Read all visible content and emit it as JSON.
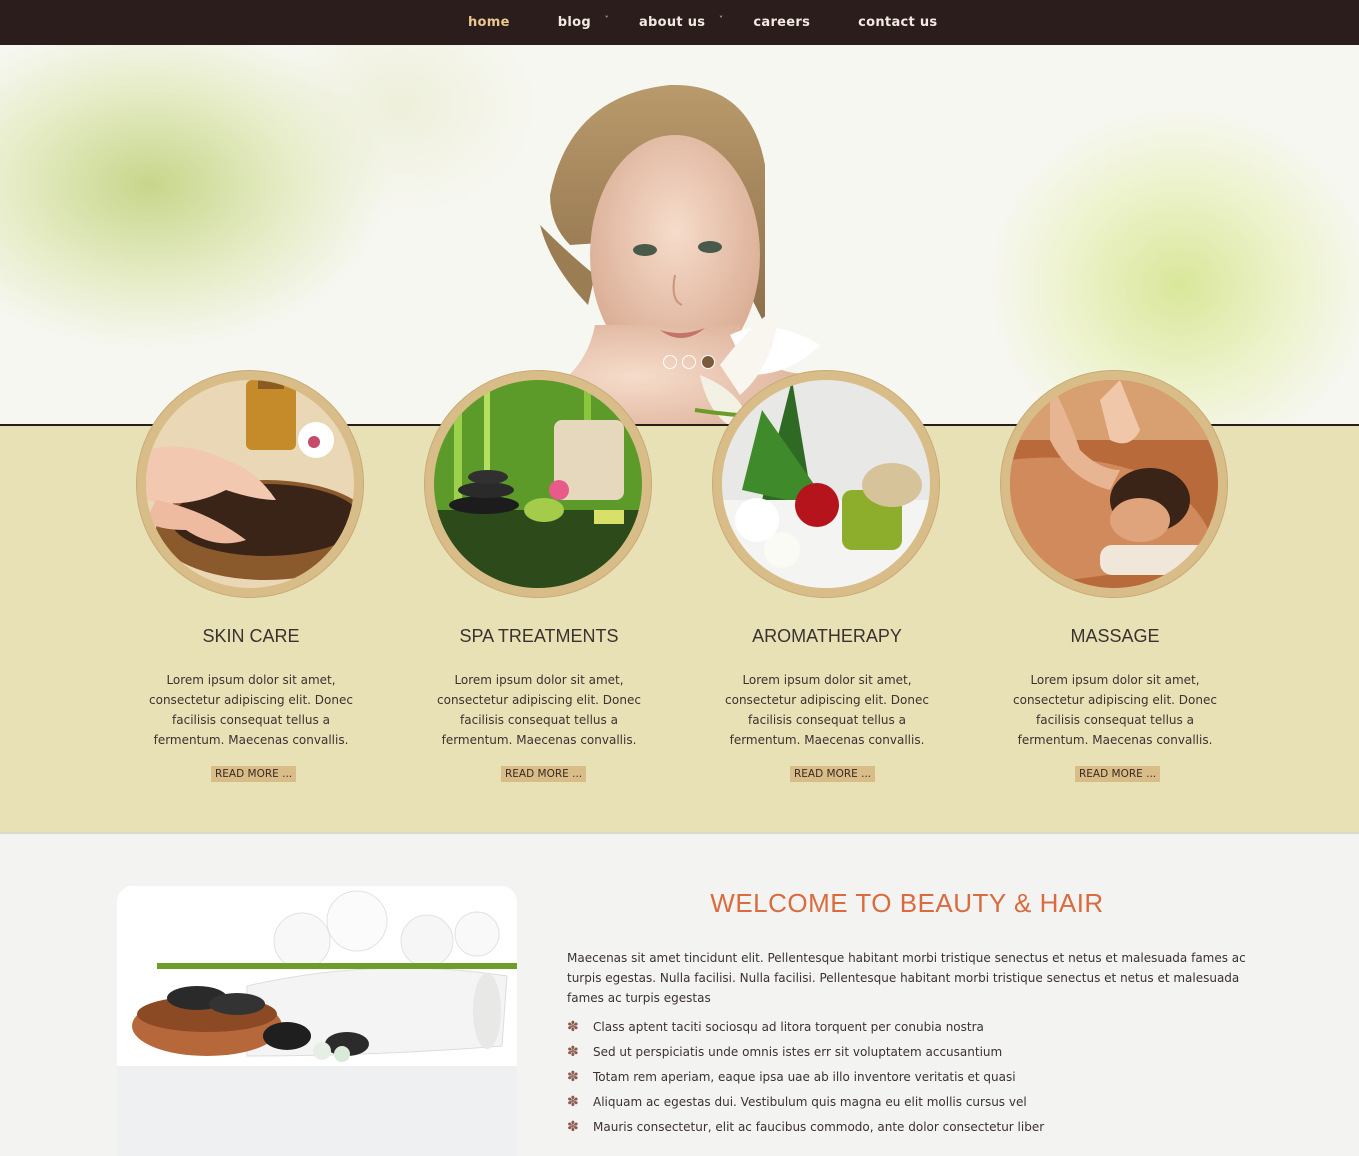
{
  "nav": {
    "items": [
      {
        "label": "home",
        "active": true,
        "caret": false
      },
      {
        "label": "blog",
        "active": false,
        "caret": true
      },
      {
        "label": "about us",
        "active": false,
        "caret": true
      },
      {
        "label": "careers",
        "active": false,
        "caret": false
      },
      {
        "label": "contact us",
        "active": false,
        "caret": false
      }
    ]
  },
  "slider": {
    "dot_count": 3,
    "active_index": 2
  },
  "features": [
    {
      "title": "SKIN CARE",
      "text": "Lorem ipsum dolor sit amet, consectetur adipiscing elit. Donec facilisis consequat tellus a fermentum. Maecenas convallis.",
      "button": "READ MORE ..."
    },
    {
      "title": "SPA TREATMENTS",
      "text": "Lorem ipsum dolor sit amet, consectetur adipiscing elit. Donec facilisis consequat tellus a fermentum. Maecenas convallis.",
      "button": "READ MORE ..."
    },
    {
      "title": "AROMATHERAPY",
      "text": "Lorem ipsum dolor sit amet, consectetur adipiscing elit. Donec facilisis consequat tellus a fermentum. Maecenas convallis.",
      "button": "READ MORE ..."
    },
    {
      "title": "MASSAGE",
      "text": "Lorem ipsum dolor sit amet, consectetur adipiscing elit. Donec facilisis consequat tellus a fermentum. Maecenas convallis.",
      "button": "READ MORE ..."
    }
  ],
  "welcome": {
    "title": "WELCOME TO BEAUTY & HAIR",
    "text": "Maecenas sit amet tincidunt elit. Pellentesque habitant morbi tristique senectus et netus et malesuada fames ac turpis egestas. Nulla facilisi. Nulla facilisi. Pellentesque habitant morbi tristique senectus et netus et malesuada fames ac turpis egestas",
    "bullets": [
      "Class aptent taciti sociosqu ad litora torquent per conubia nostra",
      "Sed ut perspiciatis unde omnis istes err sit voluptatem accusantium",
      "Totam rem aperiam, eaque ipsa uae ab illo inventore veritatis et quasi",
      "Aliquam ac egestas dui. Vestibulum quis magna eu elit mollis cursus vel",
      "Mauris consectetur, elit ac faucibus commodo, ante dolor consectetur liber"
    ],
    "bullet_icon": "flower-icon"
  },
  "colors": {
    "nav_bg": "#2b1d1c",
    "nav_active": "#e9c98f",
    "band_bg": "#e8e1b6",
    "button_bg": "#d9bd88",
    "welcome_title": "#d96b3f"
  }
}
